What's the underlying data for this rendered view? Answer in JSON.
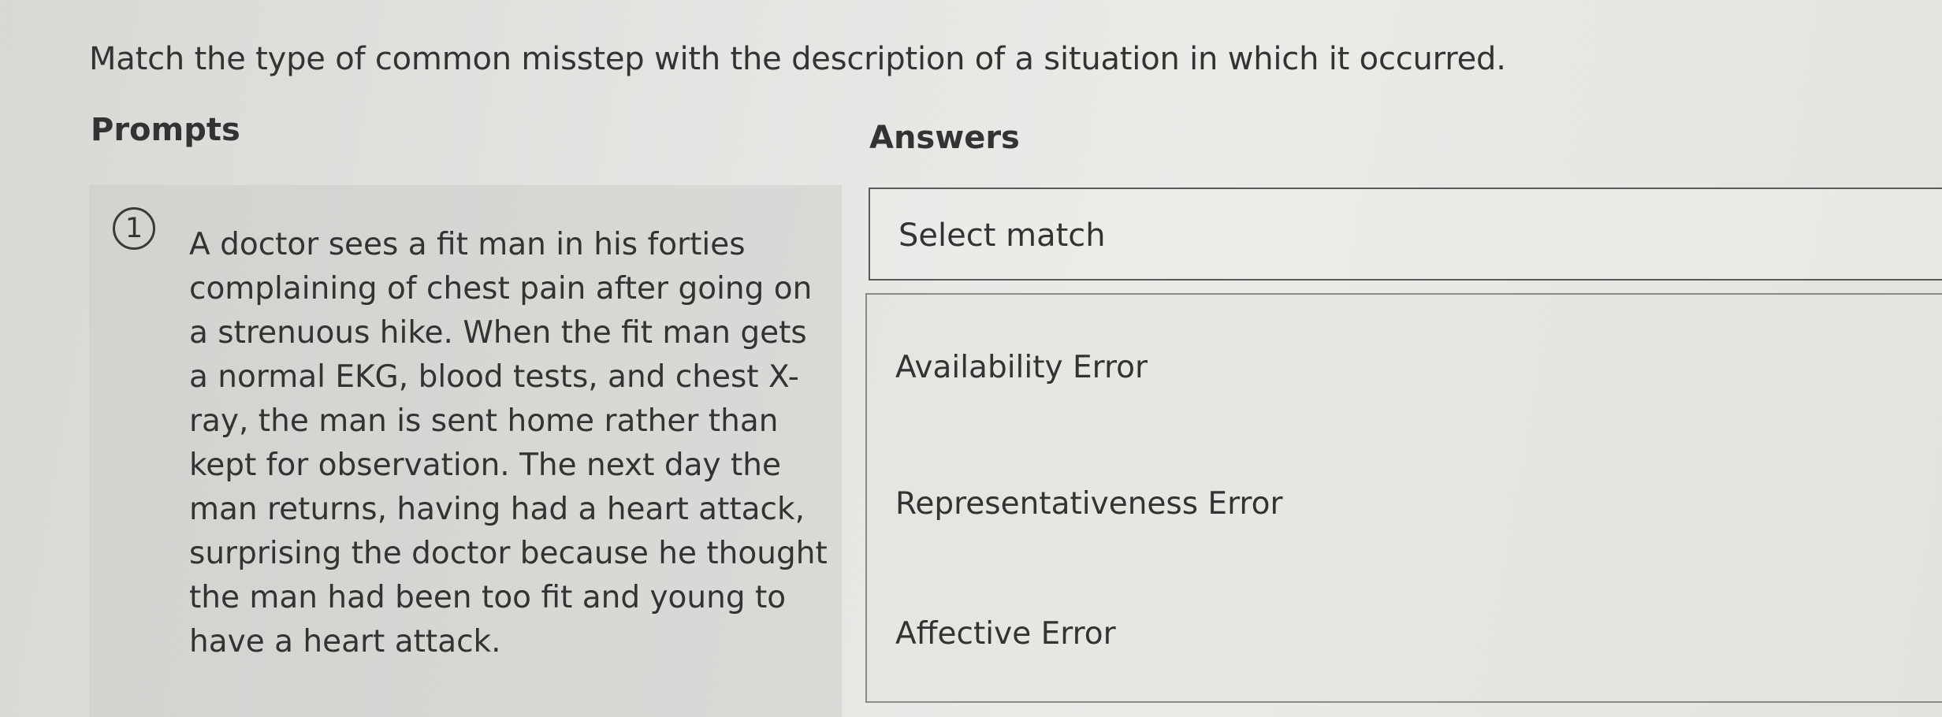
{
  "question": {
    "instruction": "Match the type of common misstep with the description of a situation in which it occurred."
  },
  "columns": {
    "prompts_heading": "Prompts",
    "answers_heading": "Answers"
  },
  "prompts": [
    {
      "number": "1",
      "text": "A doctor sees a fit man in his forties complaining of chest pain after going on a strenuous hike. When the fit man gets a normal EKG, blood tests, and chest X-ray, the man is sent home rather than kept for observation. The next day the man returns, having had a heart attack, surprising the doctor because he thought the man had been too fit and young to have a heart attack."
    }
  ],
  "answers": {
    "select_placeholder": "Select match",
    "options": [
      "Availability Error",
      "Representativeness Error",
      "Affective Error"
    ]
  }
}
